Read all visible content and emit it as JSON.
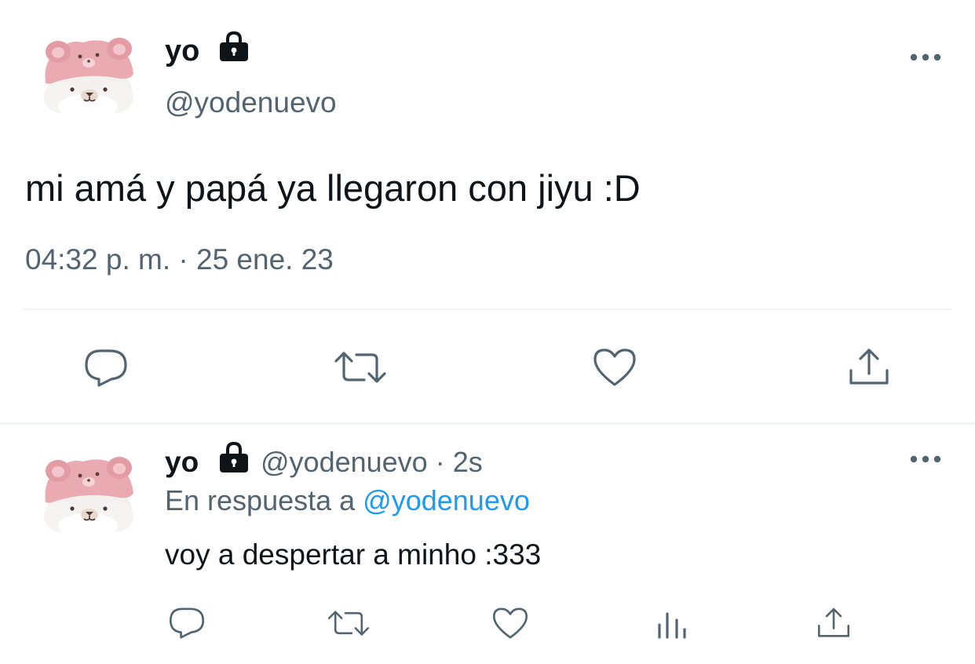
{
  "main_tweet": {
    "display_name": "yo",
    "handle": "@yodenuevo",
    "text": "mi amá y papá ya llegaron con jiyu :D",
    "meta": "04:32 p. m. · 25 ene. 23",
    "icons": {
      "avatar": "avatar-bear-pink-hood",
      "protected": "lock-icon",
      "more": "more-dots-icon",
      "actions": [
        "reply-icon",
        "retweet-icon",
        "like-icon",
        "share-icon"
      ]
    }
  },
  "reply_tweet": {
    "display_name": "yo",
    "handle": "@yodenuevo",
    "separator": " · ",
    "time": "2s",
    "reply_context_prefix": "En respuesta a ",
    "reply_context_mention": "@yodenuevo",
    "text": "voy a despertar a minho :333",
    "icons": {
      "avatar": "avatar-bear-pink-hood",
      "protected": "lock-icon",
      "more": "more-dots-icon",
      "actions": [
        "reply-icon",
        "retweet-icon",
        "like-icon",
        "analytics-icon",
        "share-icon"
      ]
    }
  },
  "colors": {
    "text_primary": "#0f1419",
    "text_secondary": "#536471",
    "link": "#1d9bf0",
    "divider": "#eff3f4",
    "avatar_hood": "#e8a9b0",
    "avatar_face": "#f4f1ef"
  }
}
